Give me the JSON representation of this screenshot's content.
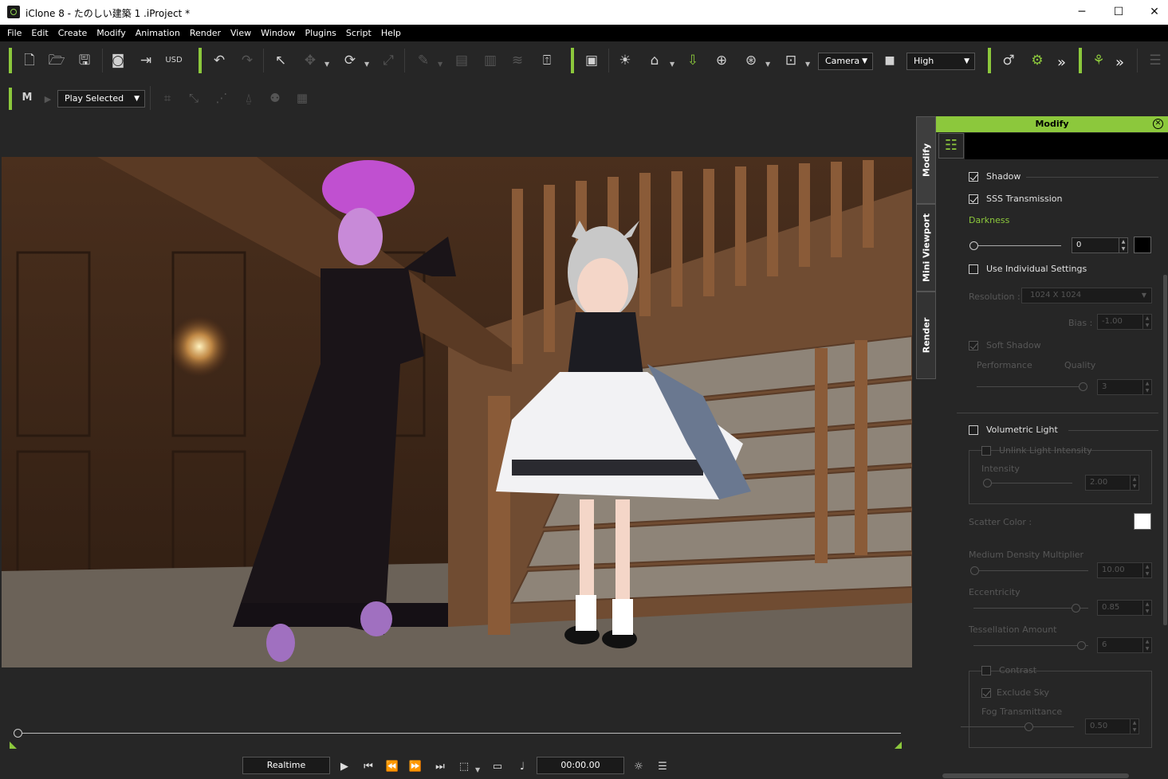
{
  "window": {
    "title": "iClone 8 - たのしい建築 1 .iProject *",
    "minimize": "─",
    "maximize": "☐",
    "close": "✕"
  },
  "menu": [
    "File",
    "Edit",
    "Create",
    "Modify",
    "Animation",
    "Render",
    "View",
    "Window",
    "Plugins",
    "Script",
    "Help"
  ],
  "toolbar": {
    "camera_select": "Camera",
    "quality_select": "High",
    "more": "»"
  },
  "toolbar2": {
    "play_mode": "Play Selected"
  },
  "side_tabs": [
    "Modify",
    "Mini Viewport",
    "Render"
  ],
  "panel": {
    "header": "Modify",
    "shadow": {
      "label": "Shadow",
      "checked": true
    },
    "sss": {
      "label": "SSS Transmission",
      "checked": true
    },
    "darkness": {
      "label": "Darkness",
      "value": "0",
      "color": "#000000"
    },
    "individual": {
      "label": "Use Individual Settings",
      "checked": false
    },
    "resolution": {
      "label": "Resolution :",
      "value": "1024  X  1024"
    },
    "bias": {
      "label": "Bias :",
      "value": "-1.00"
    },
    "soft_shadow": {
      "label": "Soft Shadow",
      "checked": true
    },
    "performance": "Performance",
    "quality": {
      "label": "Quality",
      "value": "3"
    },
    "volumetric": {
      "label": "Volumetric Light",
      "checked": false
    },
    "unlink": {
      "label": "Unlink Light Intensity",
      "checked": false
    },
    "intensity": {
      "label": "Intensity",
      "value": "2.00"
    },
    "scatter": {
      "label": "Scatter Color :",
      "color": "#ffffff"
    },
    "density": {
      "label": "Medium Density Multiplier",
      "value": "10.00"
    },
    "eccentricity": {
      "label": "Eccentricity",
      "value": "0.85"
    },
    "tessellation": {
      "label": "Tessellation Amount",
      "value": "6"
    },
    "contrast": {
      "label": "Contrast",
      "checked": false
    },
    "exclude_sky": {
      "label": "Exclude Sky",
      "checked": true
    },
    "fog": {
      "label": "Fog Transmittance",
      "value": "0.50"
    }
  },
  "playback": {
    "mode": "Realtime",
    "time": "00:00.00"
  }
}
